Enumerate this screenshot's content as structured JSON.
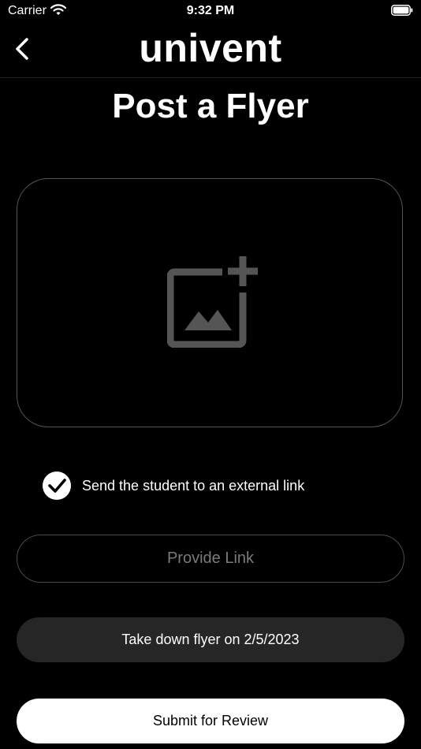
{
  "status_bar": {
    "carrier": "Carrier",
    "time": "9:32 PM"
  },
  "header": {
    "app_title": "univent",
    "back_icon": "chevron-left-icon"
  },
  "page_title": "Post a Flyer",
  "upload": {
    "icon": "add-photo-icon"
  },
  "external_link": {
    "checked": true,
    "label": "Send the student to an external link"
  },
  "link_input": {
    "value": "",
    "placeholder": "Provide Link"
  },
  "takedown_button": {
    "label": "Take down flyer on 2/5/2023"
  },
  "submit_button": {
    "label": "Submit for Review"
  },
  "colors": {
    "background": "#000000",
    "surface": "#262626",
    "border": "#4a4a4a",
    "placeholder": "#7a7a7a",
    "icon": "#555555"
  }
}
